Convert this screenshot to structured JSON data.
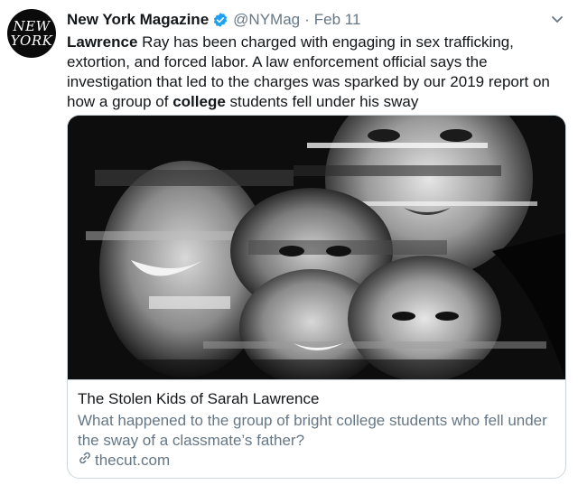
{
  "account": {
    "name": "New York Magazine",
    "handle": "@NYMag",
    "separator": "·",
    "date": "Feb 11",
    "avatar_line1": "NEW",
    "avatar_line2": "YORK"
  },
  "tweet": {
    "segments": [
      {
        "text": "Lawrence",
        "bold": true
      },
      {
        "text": " Ray has been charged with engaging in sex trafficking, extortion, and forced labor. A law enforcement official says the investigation that led to the charges was sparked by our 2019 report on how a group of ",
        "bold": false
      },
      {
        "text": "college",
        "bold": true
      },
      {
        "text": " students fell under his sway",
        "bold": false
      }
    ]
  },
  "card": {
    "image_alt": "Collage of fragmented black-and-white portraits",
    "title": "The Stolen Kids of Sarah Lawrence",
    "description": "What happened to the group of bright college students who fell under the sway of a classmate’s father?",
    "domain": "thecut.com"
  },
  "icons": {
    "verified": "verified-badge-icon",
    "caret": "chevron-down-icon",
    "link": "link-icon"
  },
  "colors": {
    "verified": "#1da1f2",
    "secondary_text": "#657786",
    "primary_text": "#14171a",
    "border": "#ccd6dd"
  }
}
